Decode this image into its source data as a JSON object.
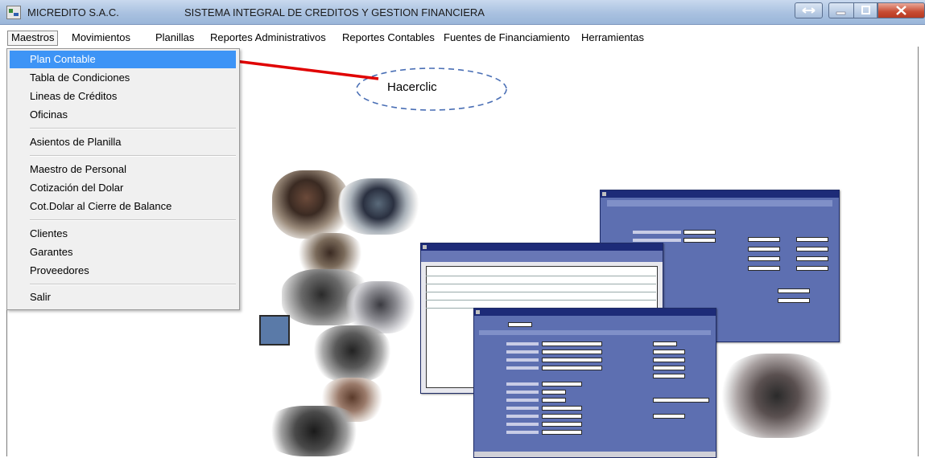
{
  "window": {
    "app_name": "MICREDITO S.A.C.",
    "title": "SISTEMA INTEGRAL DE CREDITOS Y GESTION FINANCIERA",
    "colors": {
      "titlebar": "#a9c1e0",
      "highlight": "#3d94f6",
      "close": "#c74b32"
    }
  },
  "menubar": {
    "items": [
      {
        "label": "Maestros"
      },
      {
        "label": "Movimientos"
      },
      {
        "label": "Planillas"
      },
      {
        "label": "Reportes Administrativos"
      },
      {
        "label": "Reportes Contables"
      },
      {
        "label": "Fuentes de Financiamiento"
      },
      {
        "label": "Herramientas"
      }
    ]
  },
  "dropdown": {
    "items": [
      {
        "label": "Plan Contable",
        "highlighted": true
      },
      {
        "label": "Tabla de Condiciones"
      },
      {
        "label": "Lineas de Créditos"
      },
      {
        "label": "Oficinas"
      },
      {
        "label": "Asientos de Planilla"
      },
      {
        "label": "Maestro de Personal"
      },
      {
        "label": "Cotización del Dolar"
      },
      {
        "label": "Cot.Dolar al Cierre de Balance"
      },
      {
        "label": "Clientes"
      },
      {
        "label": "Garantes"
      },
      {
        "label": "Proveedores"
      },
      {
        "label": "Salir"
      }
    ]
  },
  "callout": {
    "text": "Hacerclic",
    "arrow_color": "#e00000",
    "ellipse_color": "#4a6fb5"
  },
  "illustration": {
    "icons": [
      "office-photos-collage",
      "software-screenshot-windows",
      "team-meeting-photo"
    ]
  }
}
